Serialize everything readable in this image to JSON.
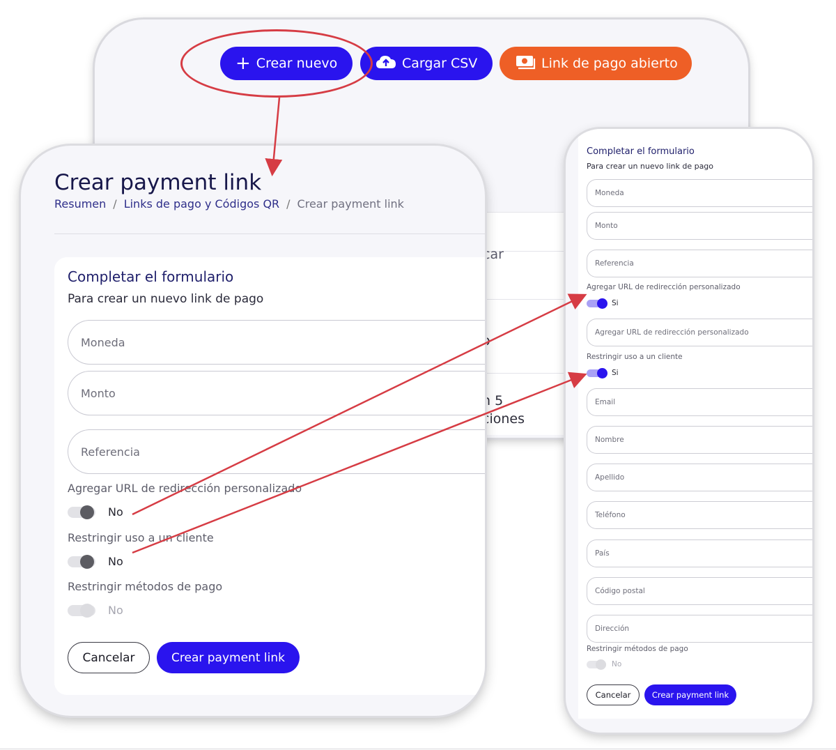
{
  "toolbar": {
    "new_label": "Crear nuevo",
    "csv_label": "Cargar CSV",
    "open_link_label": "Link de pago abierto"
  },
  "background": {
    "fragment_1": "car",
    "fragment_2": "o",
    "fragment_3": "n 5",
    "fragment_4": "ciones"
  },
  "desktop_form": {
    "title": "Crear payment link",
    "breadcrumb": [
      "Resumen",
      "Links de pago y Códigos QR",
      "Crear payment link"
    ],
    "breadcrumb_sep": "/",
    "form_title": "Completar el formulario",
    "form_subtitle": "Para crear un nuevo link de pago",
    "fields": {
      "moneda": "Moneda",
      "monto": "Monto",
      "referencia": "Referencia"
    },
    "redirect_label": "Agregar URL de redirección personalizado",
    "redirect_value": "No",
    "restrict_client_label": "Restringir uso a un cliente",
    "restrict_client_value": "No",
    "restrict_methods_label": "Restringir métodos de pago",
    "restrict_methods_value": "No",
    "cancel_label": "Cancelar",
    "submit_label": "Crear payment link"
  },
  "mobile_form": {
    "form_title": "Completar el formulario",
    "form_subtitle": "Para crear un nuevo link de pago",
    "fields": {
      "moneda": "Moneda",
      "monto": "Monto",
      "referencia": "Referencia",
      "redirect_url": "Agregar URL de redirección personalizado",
      "email": "Email",
      "nombre": "Nombre",
      "apellido": "Apellido",
      "telefono": "Teléfono",
      "pais": "País",
      "codigo_postal": "Código postal",
      "direccion": "Dirección"
    },
    "redirect_label": "Agregar URL de redirección personalizado",
    "redirect_value": "Si",
    "restrict_client_label": "Restringir uso a un cliente",
    "restrict_client_value": "Si",
    "restrict_methods_label": "Restringir métodos de pago",
    "restrict_methods_value": "No",
    "cancel_label": "Cancelar",
    "submit_label": "Crear payment link"
  },
  "colors": {
    "primary": "#2a14ee",
    "accent_orange": "#ee5f26",
    "annotation_red": "#d63c44",
    "heading": "#17174a"
  }
}
